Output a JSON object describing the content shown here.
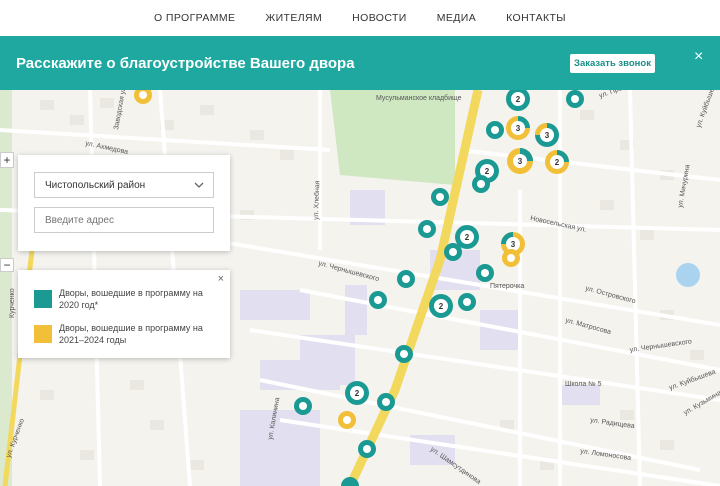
{
  "nav": {
    "items": [
      "О ПРОГРАММЕ",
      "ЖИТЕЛЯМ",
      "НОВОСТИ",
      "МЕДИА",
      "КОНТАКТЫ"
    ]
  },
  "banner": {
    "title": "Расскажите о благоустройстве Вашего двора",
    "button_label": "Заказать звонок",
    "close_label": "×"
  },
  "map": {
    "zoom_in": "+",
    "zoom_out": "−",
    "labels": [
      "Мусульманское кладбище",
      "Новосельская ул.",
      "ул. Чернышевского",
      "ул. Островского",
      "ул. Матросова",
      "ул. Чернышевского",
      "ул. Кузьмина",
      "ул. Ахмедова",
      "ул. Хлебная",
      "Заводская ул.",
      "ул. Радищева",
      "ул. Ломоносова",
      "Школа № 5",
      "Пятерочка",
      "ул. Шамсутдинова",
      "ул. Калинина",
      "ул. Куйбышева",
      "Курченко",
      "ул. Курченко",
      "ул. Мичурина",
      "ул. Куйбышева",
      "ул. Пролетарская"
    ],
    "markers": [
      {
        "type": "teal",
        "count": ""
      },
      {
        "type": "teal",
        "count": "2"
      },
      {
        "type": "teal",
        "count": ""
      },
      {
        "type": "mixed",
        "count": "3"
      },
      {
        "type": "mixed",
        "count": "3"
      },
      {
        "type": "mixed",
        "count": "3"
      },
      {
        "type": "mixed",
        "count": "2"
      },
      {
        "type": "teal",
        "count": ""
      },
      {
        "type": "teal",
        "count": "2"
      },
      {
        "type": "teal",
        "count": ""
      },
      {
        "type": "teal",
        "count": ""
      },
      {
        "type": "teal",
        "count": "2"
      },
      {
        "type": "teal",
        "count": ""
      },
      {
        "type": "mixed",
        "count": "3"
      },
      {
        "type": "yellow",
        "count": ""
      },
      {
        "type": "teal",
        "count": ""
      },
      {
        "type": "teal",
        "count": ""
      },
      {
        "type": "teal",
        "count": ""
      },
      {
        "type": "teal",
        "count": "2"
      },
      {
        "type": "teal",
        "count": ""
      },
      {
        "type": "teal",
        "count": ""
      },
      {
        "type": "teal",
        "count": "2"
      },
      {
        "type": "teal",
        "count": ""
      },
      {
        "type": "teal",
        "count": ""
      },
      {
        "type": "yellow",
        "count": ""
      },
      {
        "type": "teal",
        "count": ""
      },
      {
        "type": "teal",
        "count": ""
      },
      {
        "type": "yellow",
        "count": ""
      }
    ]
  },
  "filter": {
    "district_value": "Чистопольский район",
    "address_placeholder": "Введите адрес"
  },
  "legend": {
    "close_label": "×",
    "item_2020": "Дворы, вошедшие в программу на 2020 год*",
    "item_2021": "Дворы, вошедшие в программу на 2021–2024 годы"
  },
  "colors": {
    "accent": "#1ea8a0",
    "marker_teal": "#1a9a93",
    "marker_yellow": "#f2bf38"
  }
}
